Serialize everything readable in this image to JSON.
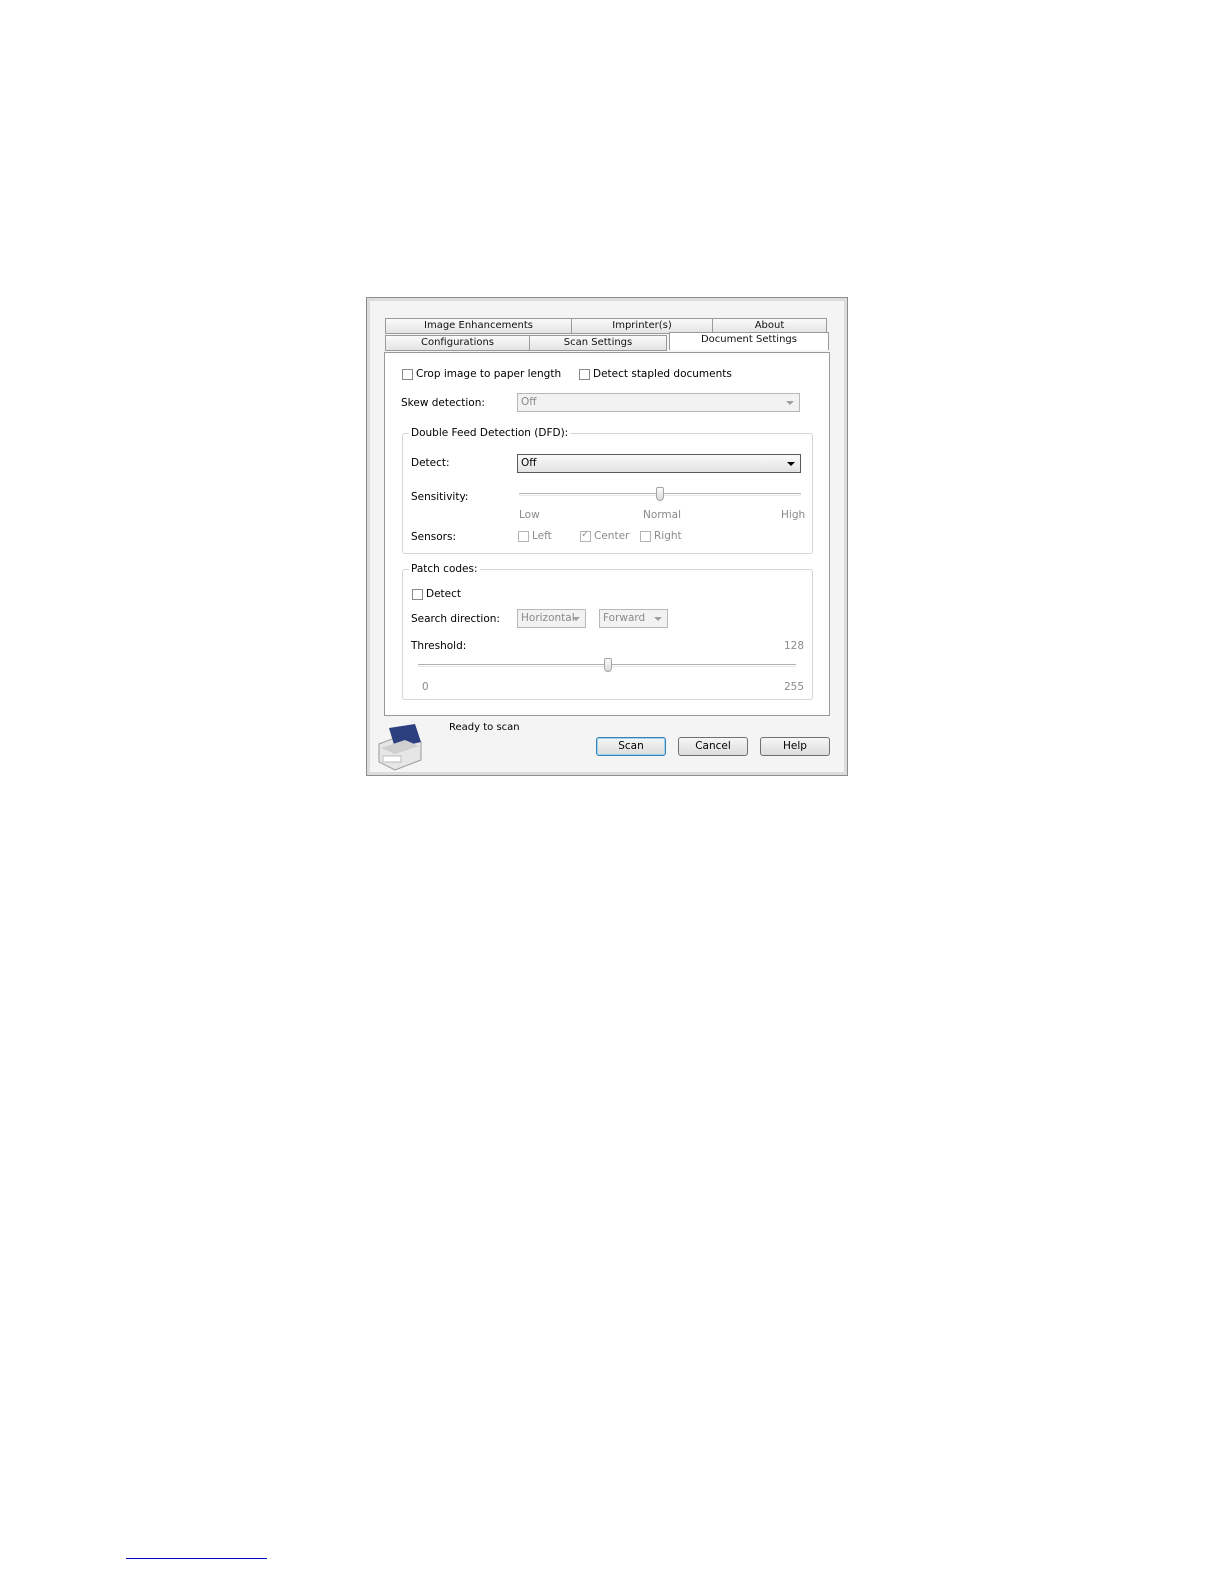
{
  "tabs": {
    "row_back": [
      {
        "label": "Image Enhancements"
      },
      {
        "label": "Imprinter(s)"
      },
      {
        "label": "About"
      }
    ],
    "row_front": [
      {
        "label": "Configurations"
      },
      {
        "label": "Scan Settings"
      },
      {
        "label": "Document Settings",
        "active": true
      }
    ]
  },
  "options": {
    "crop_label": "Crop image to paper length",
    "crop_checked": false,
    "stapled_label": "Detect stapled documents",
    "stapled_checked": false,
    "skew_label": "Skew detection:",
    "skew_value": "Off"
  },
  "dfd": {
    "title": "Double Feed Detection (DFD):",
    "detect_label": "Detect:",
    "detect_value": "Off",
    "sensitivity_label": "Sensitivity:",
    "sensitivity_low": "Low",
    "sensitivity_normal": "Normal",
    "sensitivity_high": "High",
    "sensitivity_level": 0.5,
    "sensors_label": "Sensors:",
    "sensor_left": "Left",
    "sensor_center": "Center",
    "sensor_right": "Right",
    "sensor_left_checked": false,
    "sensor_center_checked": true,
    "sensor_right_checked": false
  },
  "patch": {
    "title": "Patch codes:",
    "detect_label": "Detect",
    "detect_checked": false,
    "direction_label": "Search direction:",
    "direction_value": "Horizontal",
    "order_value": "Forward",
    "threshold_label": "Threshold:",
    "threshold_value": "128",
    "threshold_min": "0",
    "threshold_max": "255"
  },
  "status": {
    "text": "Ready to scan"
  },
  "buttons": {
    "scan": "Scan",
    "cancel": "Cancel",
    "help": "Help"
  },
  "colors": {
    "scanner_body": "#2c3f7e",
    "default_button_border": "#3c7fb1"
  }
}
